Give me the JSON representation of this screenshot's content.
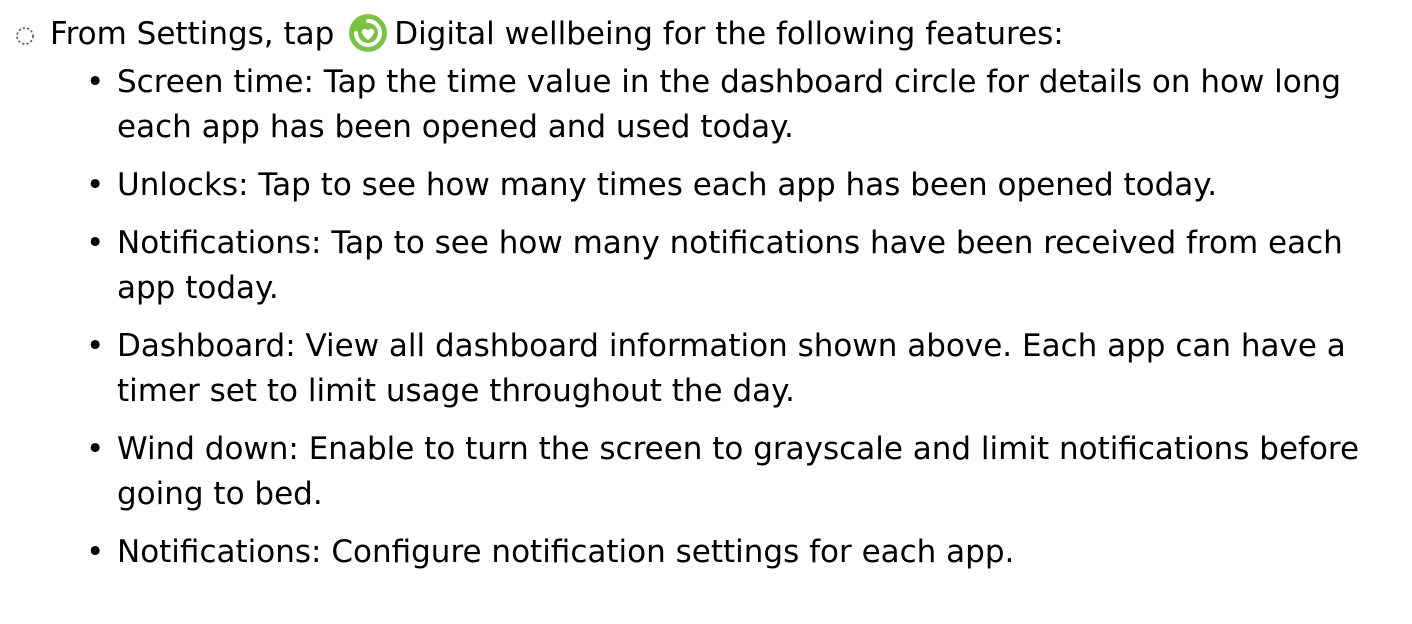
{
  "intro": {
    "before": "From Settings, tap ",
    "app_name": "Digital wellbeing",
    "after": " for the following features:",
    "icon": "digital-wellbeing-icon",
    "icon_color": "#7cc242"
  },
  "bullet_char": "•",
  "items": [
    {
      "term": "Screen time",
      "desc": ": Tap the time value in the dashboard circle for details on how long each app has been opened and used today."
    },
    {
      "term": "Unlocks",
      "desc": ": Tap to see how many times each app has been opened today."
    },
    {
      "term": "Notifications",
      "desc": ": Tap to see how many notifications have been received from each app today."
    },
    {
      "term": "Dashboard",
      "desc": ": View all dashboard information shown above. Each app can have a timer set to limit usage throughout the day."
    },
    {
      "term": "Wind down",
      "desc": ": Enable to turn the screen to grayscale and limit notifications before going to bed."
    },
    {
      "term": "Notifications",
      "desc": ": Configure notification settings for each app."
    }
  ]
}
